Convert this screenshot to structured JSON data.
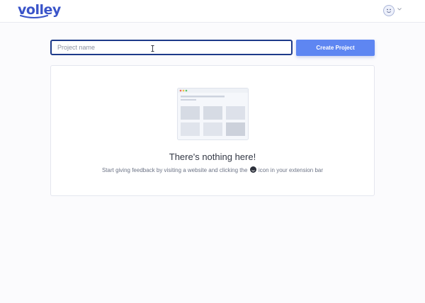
{
  "header": {
    "logo_text": "volley",
    "avatar_icon": "smiley-avatar-icon",
    "menu_icon": "chevron-down-icon"
  },
  "create_form": {
    "input_placeholder": "Project name",
    "input_value": "",
    "button_label": "Create Project"
  },
  "empty_state": {
    "illustration_icon": "browser-grid-illustration",
    "title": "There's nothing here!",
    "subtitle_before": "Start giving feedback by visiting a website and clicking the",
    "subtitle_icon": "volley-extension-icon",
    "subtitle_after": "icon in your extension bar"
  },
  "colors": {
    "brand": "#3a54c9",
    "button": "#5e86f2",
    "input_focus_border": "#1d3a8a",
    "page_background": "#fbfbfd"
  }
}
